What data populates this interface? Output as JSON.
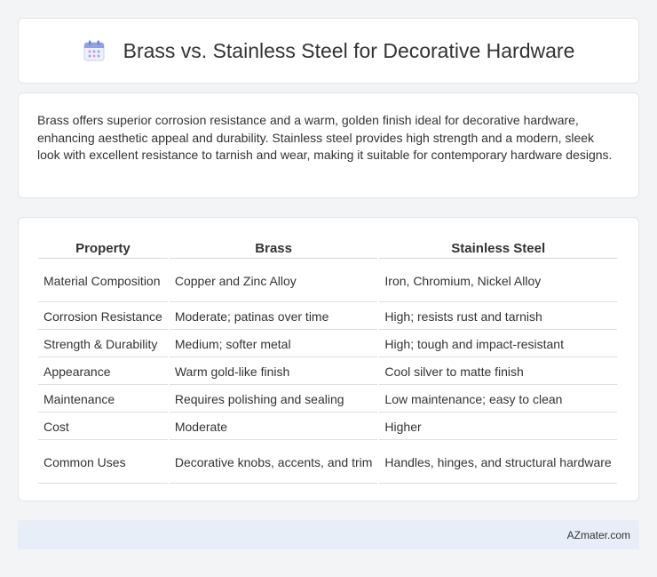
{
  "header": {
    "title": "Brass vs. Stainless Steel for Decorative Hardware",
    "icon": "calendar-icon"
  },
  "description": "Brass offers superior corrosion resistance and a warm, golden finish ideal for decorative hardware, enhancing aesthetic appeal and durability. Stainless steel provides high strength and a modern, sleek look with excellent resistance to tarnish and wear, making it suitable for contemporary hardware designs.",
  "table": {
    "headers": [
      "Property",
      "Brass",
      "Stainless Steel"
    ],
    "rows": [
      [
        "Material Composition",
        "Copper and Zinc Alloy",
        "Iron, Chromium, Nickel Alloy"
      ],
      [
        "Corrosion Resistance",
        "Moderate; patinas over time",
        "High; resists rust and tarnish"
      ],
      [
        "Strength & Durability",
        "Medium; softer metal",
        "High; tough and impact-resistant"
      ],
      [
        "Appearance",
        "Warm gold-like finish",
        "Cool silver to matte finish"
      ],
      [
        "Maintenance",
        "Requires polishing and sealing",
        "Low maintenance; easy to clean"
      ],
      [
        "Cost",
        "Moderate",
        "Higher"
      ],
      [
        "Common Uses",
        "Decorative knobs, accents, and trim",
        "Handles, hinges, and structural hardware"
      ]
    ]
  },
  "footer": {
    "text": "AZmater.com"
  },
  "colors": {
    "background": "#f3f4f6",
    "card": "#ffffff",
    "footer": "#e8eef8",
    "icon_accent": "#7b8fe0"
  }
}
